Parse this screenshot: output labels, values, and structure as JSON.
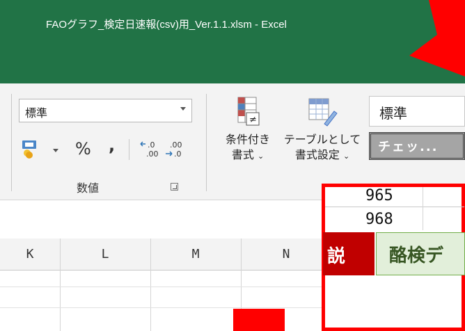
{
  "window": {
    "title": "FAOグラフ_検定日速報(csv)用_Ver.1.1.xlsm  -  Excel"
  },
  "number_group": {
    "format_value": "標準",
    "percent_label": "%",
    "comma_label": ",",
    "increase_decimal_icon": "increase-decimal-icon",
    "decrease_decimal_icon": "decrease-decimal-icon",
    "group_label": "数値"
  },
  "styles_group": {
    "conditional_format": {
      "line1": "条件付き",
      "line2": "書式"
    },
    "format_as_table": {
      "line1": "テーブルとして",
      "line2": "書式設定"
    },
    "cell_style_normal": "標準",
    "cell_style_check": "チェッ..."
  },
  "sheet": {
    "columns": [
      "K",
      "L",
      "M",
      "N"
    ],
    "cells_top": [
      "965",
      "968"
    ]
  },
  "sheet_tabs": {
    "tab_dark": "説",
    "tab_light": "酪検デ"
  },
  "colors": {
    "excel_green": "#217346",
    "annotation_red": "#ff0000",
    "tab_dark_red": "#c00000",
    "tab_light_green": "#e2efda"
  }
}
